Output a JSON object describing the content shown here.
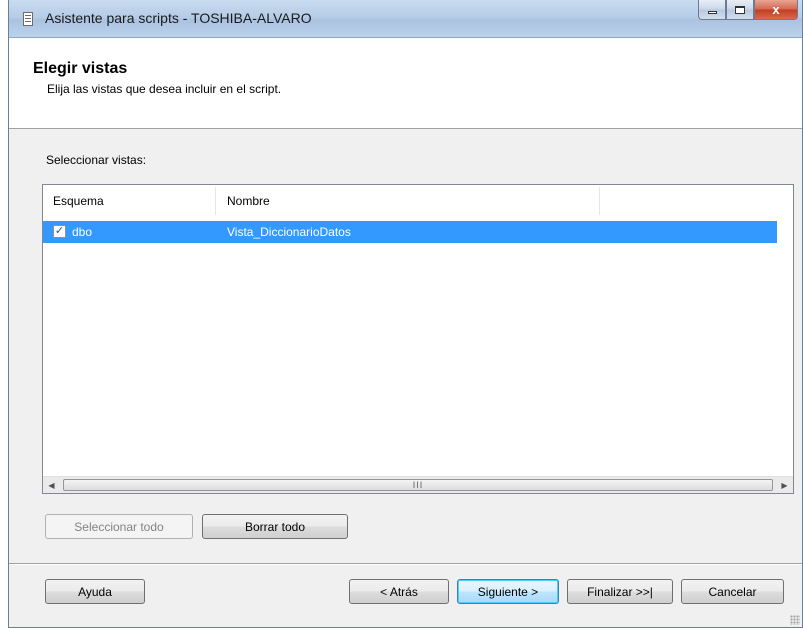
{
  "window": {
    "title": "Asistente para scripts - TOSHIBA-ALVARO",
    "close_glyph": "x"
  },
  "header": {
    "title": "Elegir vistas",
    "subtitle": "Elija las vistas que desea incluir en el script."
  },
  "main": {
    "select_label": "Seleccionar vistas:",
    "columns": [
      "Esquema",
      "Nombre"
    ],
    "rows": [
      {
        "checked": true,
        "schema": "dbo",
        "name": "Vista_DiccionarioDatos",
        "selected": true
      }
    ],
    "scrollbar_thumb_glyph": "III",
    "select_all_label": "Seleccionar todo",
    "clear_all_label": "Borrar todo"
  },
  "footer": {
    "help_label": "Ayuda",
    "back_label": "< Atrás",
    "next_label": "Siguiente >",
    "finish_label": "Finalizar >>|",
    "cancel_label": "Cancelar"
  },
  "colors": {
    "selection": "#3399ff",
    "titlebar": "#b4cbe6",
    "close_button": "#c43c22"
  }
}
